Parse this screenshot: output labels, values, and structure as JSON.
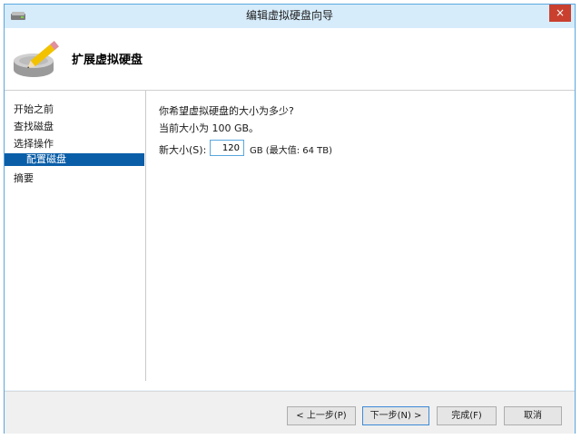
{
  "window": {
    "title": "编辑虚拟硬盘向导",
    "close_glyph": "×"
  },
  "header": {
    "title": "扩展虚拟硬盘"
  },
  "nav": {
    "items": [
      {
        "label": "开始之前"
      },
      {
        "label": "查找磁盘"
      },
      {
        "label": "选择操作"
      },
      {
        "label": "配置磁盘",
        "selected": true
      },
      {
        "label": "摘要"
      }
    ]
  },
  "main": {
    "question": "你希望虚拟硬盘的大小为多少?",
    "current_size": "当前大小为 100 GB。",
    "new_size_label": "新大小(S):",
    "new_size_value": "120",
    "new_size_suffix": "GB (最大值: 64 TB)"
  },
  "footer": {
    "prev": "< 上一步(P)",
    "next": "下一步(N) >",
    "finish": "完成(F)",
    "cancel": "取消"
  },
  "colors": {
    "accent": "#0a5ea8",
    "titlebar": "#d7ecfb",
    "close": "#c9402f"
  }
}
